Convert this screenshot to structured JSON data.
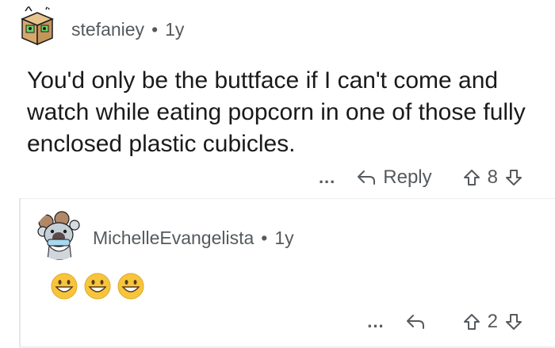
{
  "comments": [
    {
      "username": "stefaniey",
      "separator": "•",
      "age": "1y",
      "body": "You'd only be the buttface if I can't come and watch while eating popcorn in one of those fully enclosed plastic cubicles.",
      "more_label": "...",
      "reply_label": "Reply",
      "votes": "8",
      "avatar_icon": "cardboard-box-avatar-icon"
    },
    {
      "username": "MichelleEvangelista",
      "separator": "•",
      "age": "1y",
      "emojis": [
        "grinning-face",
        "grinning-face",
        "grinning-face"
      ],
      "more_label": "...",
      "reply_label": "",
      "votes": "2",
      "avatar_icon": "koala-avatar-icon"
    }
  ],
  "colors": {
    "text": "#1a1a1b",
    "meta": "#555a5e",
    "thread_line": "#e4e6e8",
    "emoji_fill": "#f7c53b"
  }
}
